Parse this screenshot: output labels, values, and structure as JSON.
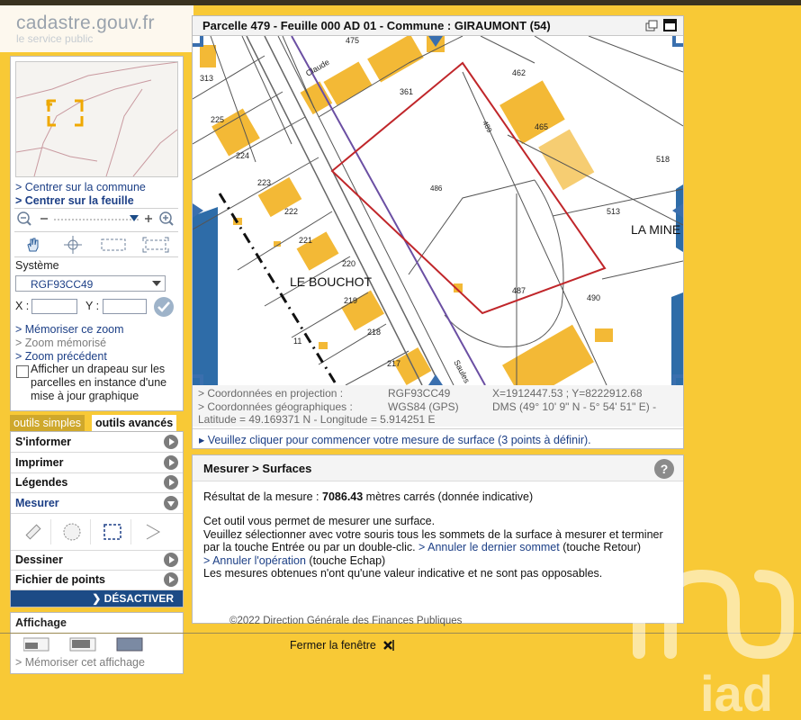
{
  "header": {
    "logo": "cadastre.gouv.fr",
    "logo_sub": "le service public"
  },
  "nav": {
    "center_commune": "> Centrer sur la commune",
    "center_feuille": "> Centrer sur la feuille",
    "systeme_label": "Système",
    "systeme_value": "RGF93CC49",
    "x_label": "X :",
    "y_label": "Y :",
    "memoriser_zoom": "> Mémoriser ce zoom",
    "zoom_memorise": "> Zoom mémorisé",
    "zoom_precedent": "> Zoom précédent",
    "drapeau_text": "Afficher un drapeau sur les parcelles en instance d'une mise à jour graphique"
  },
  "tabs": {
    "simple": "outils simples",
    "advanced": "outils avancés"
  },
  "menu": {
    "informer": "S'informer",
    "imprimer": "Imprimer",
    "legendes": "Légendes",
    "mesurer": "Mesurer",
    "dessiner": "Dessiner",
    "fichier": "Fichier de points",
    "desactiver": "DÉSACTIVER"
  },
  "affichage": {
    "title": "Affichage",
    "memoriser": "> Mémoriser cet affichage"
  },
  "map": {
    "title": "Parcelle 479 - Feuille 000 AD 01 - Commune : GIRAUMONT (54)",
    "labels": {
      "l475": "475",
      "l313": "313",
      "l361": "361",
      "l462": "462",
      "l465": "465",
      "l225": "225",
      "l224": "224",
      "l223": "223",
      "l222": "222",
      "l221": "221",
      "l220": "220",
      "l219": "219",
      "l218": "218",
      "l11": "11",
      "l217": "217",
      "l486": "486",
      "l489": "489",
      "l513": "513",
      "l518": "518",
      "l487": "487",
      "l490": "490",
      "claude": "Claude",
      "saules": "Saules",
      "lieu1": "LE   BOUCHOT",
      "lieu2": "LA MINE"
    }
  },
  "coords": {
    "proj_label": "> Coordonnées en projection :",
    "proj_sys": "RGF93CC49",
    "proj_val": "X=1912447.53 ; Y=8222912.68",
    "geo_label": "> Coordonnées géographiques :",
    "geo_sys": "WGS84 (GPS)",
    "geo_dms": "DMS (49° 10' 9\" N - 5° 54' 51\" E) -",
    "geo_dec": "Latitude = 49.169371 N - Longitude = 5.914251 E"
  },
  "instruction": "▸ Veuillez cliquer pour commencer votre mesure de surface (3 points à définir).",
  "measure": {
    "title": "Mesurer > Surfaces",
    "result_label": "Résultat de la mesure : ",
    "result_value": "7086.43",
    "result_unit": " mètres carrés (donnée indicative)",
    "p1": "Cet outil vous permet de mesurer une surface.",
    "p2a": "Veuillez sélectionner avec votre souris tous les sommets de la surface à mesurer et terminer",
    "p2b": "par la touche Entrée ou par un double-clic. ",
    "p2c": "> Annuler le dernier sommet",
    "p2d": " (touche Retour)",
    "p3a": "> Annuler l'opération",
    "p3b": " (touche Echap)",
    "p4": "Les mesures obtenues n'ont qu'une valeur indicative et ne sont pas opposables."
  },
  "footer": {
    "copyright": "©2022 Direction Générale des Finances Publiques",
    "close": "Fermer la fenêtre",
    "watermark": "iad"
  },
  "colors": {
    "background": "#f8c936",
    "link": "#1c3f86",
    "parcel_outline": "#c0262a",
    "building": "#f3b936",
    "water": "#2e6ca8"
  }
}
